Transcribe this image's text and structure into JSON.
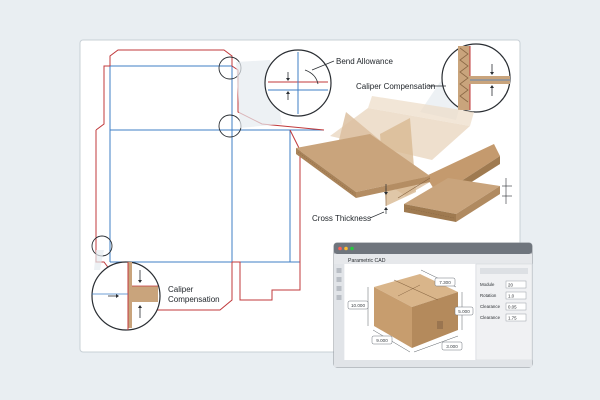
{
  "annotations": {
    "bend_allowance": "Bend Allowance",
    "caliper_compensation_top": "Caliper Compensation",
    "cross_thickness": "Cross Thickness",
    "caliper_line1": "Caliper",
    "caliper_line2": "Compensation"
  },
  "cad_window": {
    "title": "Parametric CAD",
    "dimensions": {
      "depth": "7.300",
      "height": "10.000",
      "right": "5.000",
      "width": "9.000",
      "bottom": "3.000"
    },
    "properties": [
      {
        "label": "Module",
        "value": "20"
      },
      {
        "label": "Rotation",
        "value": "1.0"
      },
      {
        "label": "Clearance",
        "value": "0.05"
      },
      {
        "label": "Clearance",
        "value": "1.75"
      }
    ]
  },
  "colors": {
    "cut_line": "#c0393b",
    "crease_line": "#3f7fc6",
    "cardboard": "#c9a47c",
    "cardboard_dark": "#a98359"
  }
}
